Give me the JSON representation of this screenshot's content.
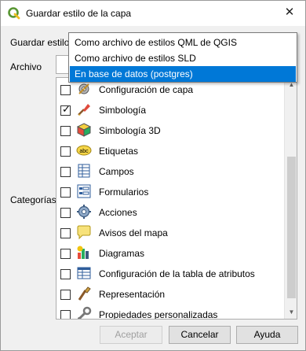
{
  "window": {
    "title": "Guardar estilo de la capa",
    "close_glyph": "✕"
  },
  "form": {
    "guardar_estilo_label": "Guardar estilo",
    "archivo_label": "Archivo",
    "categorias_label": "Categorías"
  },
  "dropdown": {
    "options": [
      "Como archivo de estilos QML de QGIS",
      "Como archivo de estilos SLD",
      "En base de datos (postgres)"
    ],
    "selected_index": 2
  },
  "categories": [
    {
      "label": "Configuración de capa",
      "checked": false,
      "icon": "layer-config-icon"
    },
    {
      "label": "Simbología",
      "checked": true,
      "icon": "symbology-icon"
    },
    {
      "label": "Simbología 3D",
      "checked": false,
      "icon": "symbology-3d-icon"
    },
    {
      "label": "Etiquetas",
      "checked": false,
      "icon": "labels-icon",
      "icon_text": "abc"
    },
    {
      "label": "Campos",
      "checked": false,
      "icon": "fields-icon"
    },
    {
      "label": "Formularios",
      "checked": false,
      "icon": "forms-icon"
    },
    {
      "label": "Acciones",
      "checked": false,
      "icon": "actions-icon"
    },
    {
      "label": "Avisos del mapa",
      "checked": false,
      "icon": "map-tips-icon"
    },
    {
      "label": "Diagramas",
      "checked": false,
      "icon": "diagrams-icon"
    },
    {
      "label": "Configuración de la tabla de atributos",
      "checked": false,
      "icon": "attribute-table-icon"
    },
    {
      "label": "Representación",
      "checked": false,
      "icon": "rendering-icon"
    },
    {
      "label": "Propiedades personalizadas",
      "checked": false,
      "icon": "custom-properties-icon"
    }
  ],
  "buttons": {
    "accept": "Aceptar",
    "cancel": "Cancelar",
    "help": "Ayuda"
  },
  "colors": {
    "selection": "#0078d7",
    "qgis_green": "#589632",
    "qgis_yellow": "#eebe1e"
  }
}
